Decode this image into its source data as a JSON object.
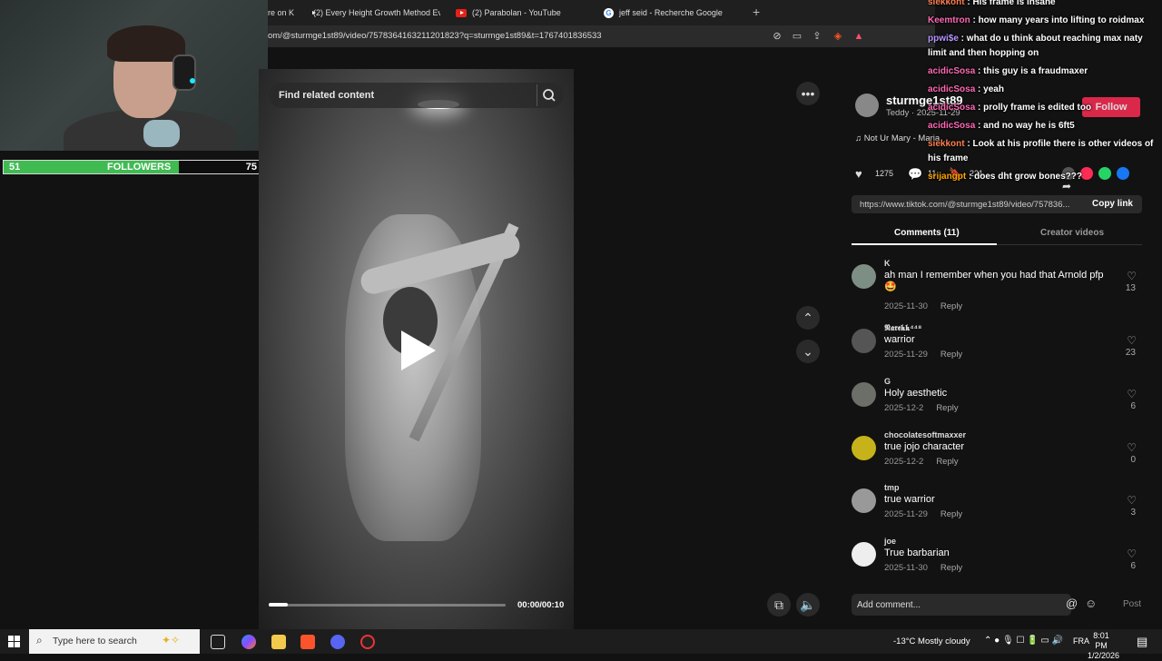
{
  "stream": {
    "followers_current": "51",
    "followers_label": "FOLLOWERS",
    "followers_goal": "75",
    "followers_progress": 0.68
  },
  "browser": {
    "tabs": [
      {
        "label": "re on K"
      },
      {
        "label": "(2) Every Height Growth Method Eve",
        "icon": "youtube-icon"
      },
      {
        "label": "(2) Parabolan - YouTube",
        "icon": "youtube-icon"
      },
      {
        "label": "jeff seid - Recherche Google",
        "icon": "google-icon"
      }
    ],
    "new_tab": "+",
    "url": "om/@sturmge1st89/video/7578364163211201823?q=sturmge1st89&t=1767401836533"
  },
  "video": {
    "search_placeholder": "Find related content",
    "timecode": "00:00/00:10",
    "progress": 0.08
  },
  "post": {
    "author": "sturmge1st89",
    "author_sub": "Teddy · 2025-11-29",
    "follow_label": "Follow",
    "music": "♫  Not Ur Mary - Maria",
    "likes": "1275",
    "comments_count": "11",
    "saves": "221",
    "link": "https://www.tiktok.com/@sturmge1st89/video/757836...",
    "copy_link": "Copy link"
  },
  "tabs": {
    "comments": "Comments (11)",
    "creator": "Creator videos"
  },
  "comments": [
    {
      "user": "K",
      "text": "ah man I remember when you had that Arnold pfp 🤩",
      "date": "2025-11-30",
      "reply": "Reply",
      "likes": "13",
      "avatar_color": "#7d8f85"
    },
    {
      "user": "𝕹𝖆𝖗𝖊𝖐𝖐⁴⁴⁸",
      "text": "warrior",
      "date": "2025-11-29",
      "reply": "Reply",
      "likes": "23",
      "avatar_color": "#555"
    },
    {
      "user": "G",
      "text": "Holy aesthetic",
      "date": "2025-12-2",
      "reply": "Reply",
      "likes": "6",
      "avatar_color": "#6b6f68"
    },
    {
      "user": "chocolatesoftmaxxer",
      "text": "true jojo character",
      "date": "2025-12-2",
      "reply": "Reply",
      "likes": "0",
      "avatar_color": "#c7b21a"
    },
    {
      "user": "tmp",
      "text": "true warrior",
      "date": "2025-11-29",
      "reply": "Reply",
      "likes": "3",
      "avatar_color": "#999"
    },
    {
      "user": "joe",
      "text": "True barbarian",
      "date": "2025-11-30",
      "reply": "Reply",
      "likes": "6",
      "avatar_color": "#eee"
    }
  ],
  "comment_box": {
    "placeholder": "Add comment...",
    "post_label": "Post"
  },
  "chat": [
    {
      "user": "siekkont",
      "color": "#ff7f50",
      "message": " : His frame is insane"
    },
    {
      "user": "Keemtron",
      "color": "#ff69b4",
      "message": " : how many years into lifting to roidmax"
    },
    {
      "user": "ppwi$e",
      "color": "#b695ff",
      "message": " : what do u think about reaching max naty limit and then hopping on"
    },
    {
      "user": "acidicSosa",
      "color": "#ff69b4",
      "message": " : this guy is a fraudmaxer"
    },
    {
      "user": "acidicSosa",
      "color": "#ff69b4",
      "message": " : yeah"
    },
    {
      "user": "acidicSosa",
      "color": "#ff69b4",
      "message": " : prolly frame is edited too"
    },
    {
      "user": "acidicSosa",
      "color": "#ff69b4",
      "message": " : and no way he is 6ft5"
    },
    {
      "user": "siekkont",
      "color": "#ff7f50",
      "message": " : Look at his profile there is other videos of his frame"
    },
    {
      "user": "srijangpt",
      "color": "#ffa500",
      "message": " : does dht grow bones???"
    }
  ],
  "taskbar": {
    "search_placeholder": "Type here to search",
    "weather": "-13°C  Mostly cloudy",
    "language": "FRA",
    "time": "8:01 PM",
    "date": "1/2/2026"
  },
  "colors": {
    "accent": "#fe2c55",
    "followers_bar": "#3fbb52"
  }
}
